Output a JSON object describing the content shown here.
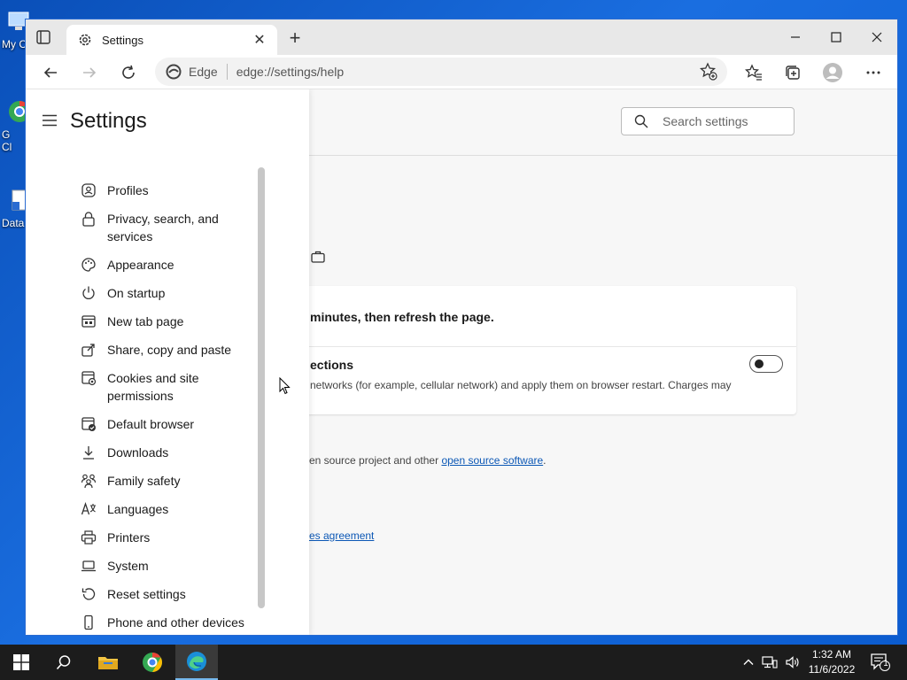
{
  "desktop": {
    "icons": [
      {
        "label": "My C",
        "color": "#3b82f6"
      },
      {
        "label": "G\nCl",
        "color": "#ea4335"
      },
      {
        "label": "Data",
        "color": "#ffffff"
      }
    ]
  },
  "browser": {
    "tab_title": "Settings",
    "address_site": "Edge",
    "address_url": "edge://settings/help",
    "accent_color": "#0b57b5"
  },
  "sidebar": {
    "title": "Settings",
    "items": [
      {
        "label": "Profiles",
        "icon": "profile-icon"
      },
      {
        "label": "Privacy, search, and services",
        "icon": "lock-icon"
      },
      {
        "label": "Appearance",
        "icon": "palette-icon"
      },
      {
        "label": "On startup",
        "icon": "power-icon"
      },
      {
        "label": "New tab page",
        "icon": "new-tab-icon"
      },
      {
        "label": "Share, copy and paste",
        "icon": "share-icon"
      },
      {
        "label": "Cookies and site permissions",
        "icon": "cookies-icon"
      },
      {
        "label": "Default browser",
        "icon": "default-browser-icon"
      },
      {
        "label": "Downloads",
        "icon": "download-icon"
      },
      {
        "label": "Family safety",
        "icon": "family-icon"
      },
      {
        "label": "Languages",
        "icon": "languages-icon"
      },
      {
        "label": "Printers",
        "icon": "printer-icon"
      },
      {
        "label": "System",
        "icon": "laptop-icon"
      },
      {
        "label": "Reset settings",
        "icon": "reset-icon"
      },
      {
        "label": "Phone and other devices",
        "icon": "phone-icon"
      }
    ]
  },
  "search": {
    "placeholder": "Search settings"
  },
  "main": {
    "card_row1": "minutes, then refresh the page.",
    "card_row2_title": "ections",
    "card_row2_desc": "networks (for example, cellular network) and apply them on browser restart. Charges may",
    "toggle_on": false,
    "oss_text": "en source project and other ",
    "oss_link": "open source software",
    "oss_end": ".",
    "tos_link": "es agreement"
  },
  "taskbar": {
    "time": "1:32 AM",
    "date": "11/6/2022",
    "notification_count": "1"
  }
}
